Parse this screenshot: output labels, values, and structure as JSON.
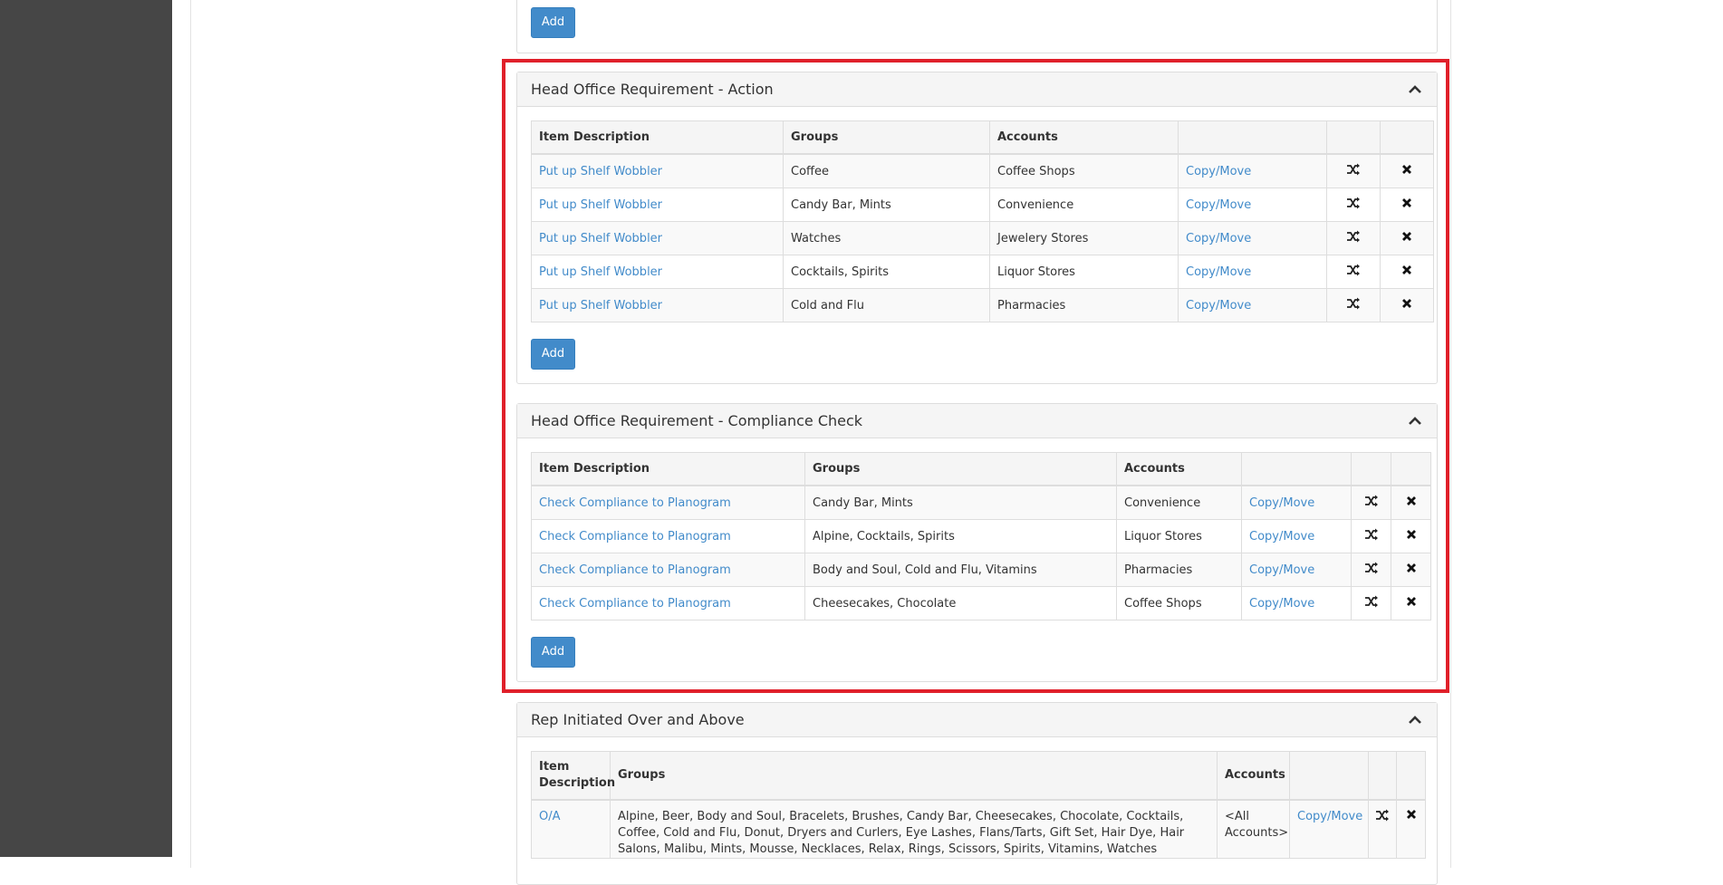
{
  "add_label": "Add",
  "copy_move": "Copy/Move",
  "colors": {
    "accent": "#428bca",
    "highlight": "#e0202a",
    "sidebar": "#464646"
  },
  "panels": [
    {
      "title": "Head Office Requirement - Action",
      "headers": [
        "Item Description",
        "Groups",
        "Accounts"
      ],
      "rows": [
        {
          "item": "Put up Shelf Wobbler",
          "groups": "Coffee",
          "accounts": "Coffee Shops"
        },
        {
          "item": "Put up Shelf Wobbler",
          "groups": "Candy Bar, Mints",
          "accounts": "Convenience"
        },
        {
          "item": "Put up Shelf Wobbler",
          "groups": "Watches",
          "accounts": "Jewelery Stores"
        },
        {
          "item": "Put up Shelf Wobbler",
          "groups": "Cocktails, Spirits",
          "accounts": "Liquor Stores"
        },
        {
          "item": "Put up Shelf Wobbler",
          "groups": "Cold and Flu",
          "accounts": "Pharmacies"
        }
      ]
    },
    {
      "title": "Head Office Requirement - Compliance Check",
      "headers": [
        "Item Description",
        "Groups",
        "Accounts"
      ],
      "rows": [
        {
          "item": "Check Compliance to Planogram",
          "groups": "Candy Bar, Mints",
          "accounts": "Convenience"
        },
        {
          "item": "Check Compliance to Planogram",
          "groups": "Alpine, Cocktails, Spirits",
          "accounts": "Liquor Stores"
        },
        {
          "item": "Check Compliance to Planogram",
          "groups": "Body and Soul, Cold and Flu, Vitamins",
          "accounts": "Pharmacies"
        },
        {
          "item": "Check Compliance to Planogram",
          "groups": "Cheesecakes, Chocolate",
          "accounts": "Coffee Shops"
        }
      ]
    },
    {
      "title": "Rep Initiated Over and Above",
      "headers": [
        "Item Description",
        "Groups",
        "Accounts"
      ],
      "rows": [
        {
          "item": "O/A",
          "groups": "Alpine, Beer, Body and Soul, Bracelets, Brushes, Candy Bar, Cheesecakes, Chocolate, Cocktails, Coffee, Cold and Flu, Donut, Dryers and Curlers, Eye Lashes, Flans/Tarts, Gift Set, Hair Dye, Hair Salons, Malibu, Mints, Mousse, Necklaces, Relax, Rings, Scissors, Spirits, Vitamins, Watches",
          "accounts": "<All Accounts>"
        }
      ]
    }
  ],
  "icons": {
    "move": "shuffle-icon",
    "delete": "close-icon",
    "collapse": "chevron-up-icon"
  }
}
